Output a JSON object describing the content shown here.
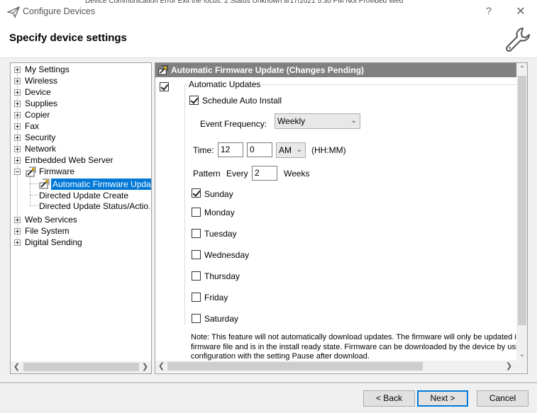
{
  "window": {
    "title": "Configure Devices",
    "help_label": "?",
    "close_label": "✕",
    "background_text": "Device Communication Error    Exit the focus: 2          Status Unknown                          8/17/2021 5:30 PM         Not Provided Wed"
  },
  "header": {
    "title": "Specify device settings"
  },
  "tree": {
    "items": [
      {
        "label": "My Settings"
      },
      {
        "label": "Wireless"
      },
      {
        "label": "Device"
      },
      {
        "label": "Supplies"
      },
      {
        "label": "Copier"
      },
      {
        "label": "Fax"
      },
      {
        "label": "Security"
      },
      {
        "label": "Network"
      },
      {
        "label": "Embedded Web Server"
      },
      {
        "label": "Firmware"
      },
      {
        "label": "Automatic Firmware Upda..."
      },
      {
        "label": "Directed Update Create"
      },
      {
        "label": "Directed Update Status/Actio..."
      },
      {
        "label": "Web Services"
      },
      {
        "label": "File System"
      },
      {
        "label": "Digital Sending"
      }
    ]
  },
  "panel": {
    "title": "Automatic Firmware Update (Changes Pending)",
    "group_label": "Automatic Updates",
    "schedule_label": "Schedule Auto Install",
    "event_frequency_label": "Event Frequency:",
    "event_frequency_value": "Weekly",
    "time_label": "Time:",
    "hour_value": "12",
    "minute_value": "0",
    "ampm_value": "AM",
    "time_format": "(HH:MM)",
    "pattern_label": "Pattern",
    "every_label": "Every",
    "weeks_value": "2",
    "weeks_label": "Weeks",
    "days": [
      {
        "label": "Sunday",
        "checked": true
      },
      {
        "label": "Monday",
        "checked": false
      },
      {
        "label": "Tuesday",
        "checked": false
      },
      {
        "label": "Wednesday",
        "checked": false
      },
      {
        "label": "Thursday",
        "checked": false
      },
      {
        "label": "Friday",
        "checked": false
      },
      {
        "label": "Saturday",
        "checked": false
      }
    ],
    "note_lines": [
      "Note: This feature will not automatically download updates. The firmware will only be updated if the",
      "firmware file and is in the install ready state. Firmware can be downloaded by the device by using the",
      "configuration with the setting Pause after download."
    ]
  },
  "buttons": {
    "back": "< Back",
    "next": "Next >",
    "cancel": "Cancel"
  },
  "colors": {
    "selection": "#0078d7",
    "panel_header": "#808080"
  }
}
